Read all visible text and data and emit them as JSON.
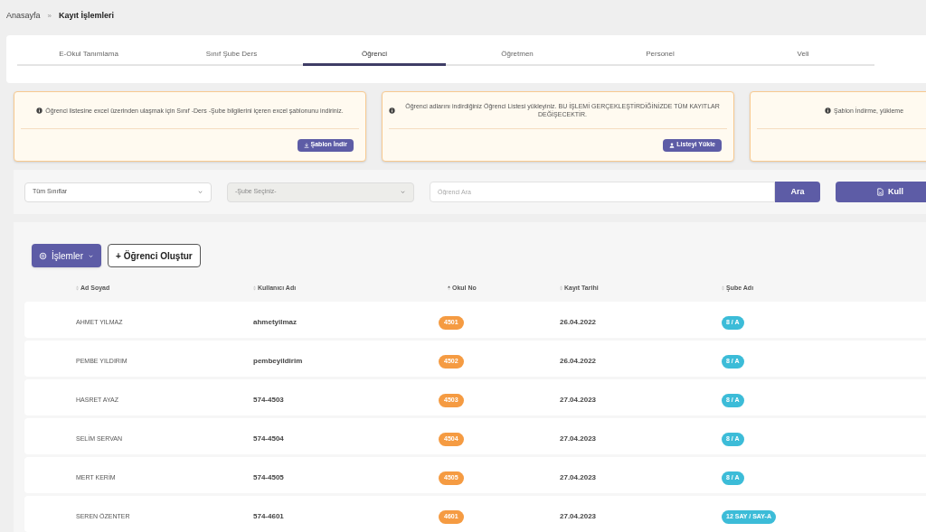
{
  "breadcrumb": {
    "home": "Anasayfa",
    "separator": "»",
    "current": "Kayıt İşlemleri"
  },
  "tabs": [
    {
      "label": "E-Okul Tanımlama",
      "selected": false
    },
    {
      "label": "Sınıf Şube Ders",
      "selected": false
    },
    {
      "label": "Öğrenci",
      "selected": true
    },
    {
      "label": "Öğretmen",
      "selected": false
    },
    {
      "label": "Personel",
      "selected": false
    },
    {
      "label": "Veli",
      "selected": false
    }
  ],
  "info_cards": [
    {
      "text": "Öğrenci listesine excel üzerinden ulaşmak için Sınıf -Ders -Şube bilgilerini içeren excel şablonunu indiriniz.",
      "button": "Şablon İndir"
    },
    {
      "text": "Öğrenci adlarını indirdiğiniz Öğrenci Listesi yükleyiniz. BU İŞLEMİ GERÇEKLEŞTİRDİĞİNİZDE TÜM KAYITLAR DEĞİŞECEKTİR.",
      "button": "Listeyi Yükle"
    },
    {
      "text": "Şablon İndirme, yükleme"
    }
  ],
  "filters": {
    "class_select": {
      "value": "Tüm Sınıflar",
      "disabled": false
    },
    "branch_select": {
      "value": "-Şube Seçiniz-",
      "disabled": true
    },
    "search": {
      "placeholder": "Öğrenci Ara"
    },
    "search_button": "Ara",
    "export_button": "Kull"
  },
  "actions": {
    "menu_button": "İşlemler",
    "create_button": "+ Öğrenci Oluştur"
  },
  "table": {
    "columns": [
      {
        "label": "Ad Soyad",
        "sorted": false
      },
      {
        "label": "Kullanıcı Adı",
        "sorted": false
      },
      {
        "label": "Okul No",
        "sorted": true
      },
      {
        "label": "Kayıt Tarihi",
        "sorted": false
      },
      {
        "label": "Şube Adı",
        "sorted": false
      }
    ],
    "rows": [
      {
        "name": "AHMET YILMAZ",
        "username": "ahmetyilmaz",
        "school_no": "4501",
        "date": "26.04.2022",
        "branch": "8 / A"
      },
      {
        "name": "PEMBE YILDIRIM",
        "username": "pembeyildirim",
        "school_no": "4502",
        "date": "26.04.2022",
        "branch": "8 / A"
      },
      {
        "name": "HASRET AYAZ",
        "username": "574-4503",
        "school_no": "4503",
        "date": "27.04.2023",
        "branch": "8 / A"
      },
      {
        "name": "SELİM SERVAN",
        "username": "574-4504",
        "school_no": "4504",
        "date": "27.04.2023",
        "branch": "8 / A"
      },
      {
        "name": "MERT KERİM",
        "username": "574-4505",
        "school_no": "4505",
        "date": "27.04.2023",
        "branch": "8 / A"
      },
      {
        "name": "SEREN ÖZENTER",
        "username": "574-4601",
        "school_no": "4601",
        "date": "27.04.2023",
        "branch": "12 SAY / SAY-A"
      }
    ]
  }
}
